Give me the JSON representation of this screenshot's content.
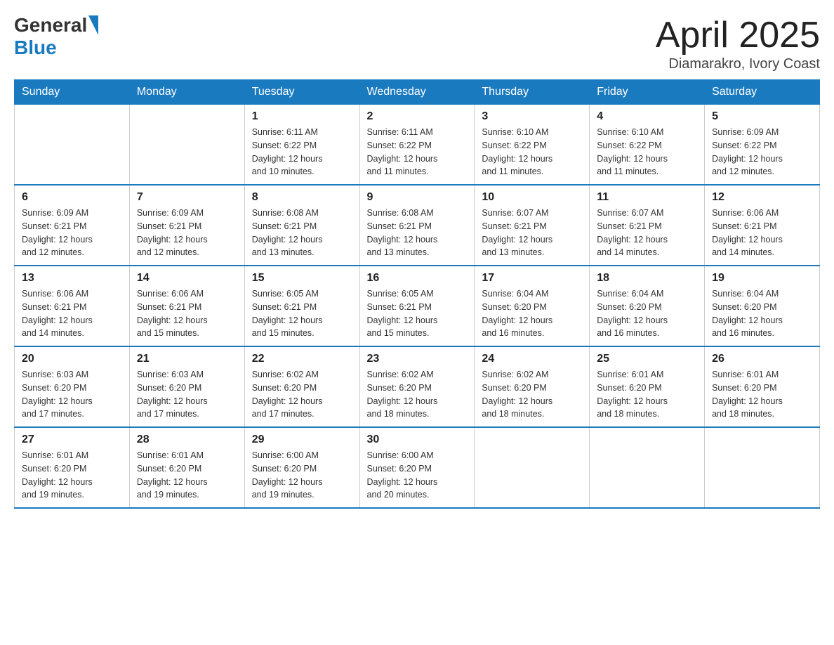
{
  "header": {
    "logo_general": "General",
    "logo_blue": "Blue",
    "month_title": "April 2025",
    "location": "Diamarakro, Ivory Coast"
  },
  "days_of_week": [
    "Sunday",
    "Monday",
    "Tuesday",
    "Wednesday",
    "Thursday",
    "Friday",
    "Saturday"
  ],
  "weeks": [
    [
      {
        "day": "",
        "info": ""
      },
      {
        "day": "",
        "info": ""
      },
      {
        "day": "1",
        "info": "Sunrise: 6:11 AM\nSunset: 6:22 PM\nDaylight: 12 hours\nand 10 minutes."
      },
      {
        "day": "2",
        "info": "Sunrise: 6:11 AM\nSunset: 6:22 PM\nDaylight: 12 hours\nand 11 minutes."
      },
      {
        "day": "3",
        "info": "Sunrise: 6:10 AM\nSunset: 6:22 PM\nDaylight: 12 hours\nand 11 minutes."
      },
      {
        "day": "4",
        "info": "Sunrise: 6:10 AM\nSunset: 6:22 PM\nDaylight: 12 hours\nand 11 minutes."
      },
      {
        "day": "5",
        "info": "Sunrise: 6:09 AM\nSunset: 6:22 PM\nDaylight: 12 hours\nand 12 minutes."
      }
    ],
    [
      {
        "day": "6",
        "info": "Sunrise: 6:09 AM\nSunset: 6:21 PM\nDaylight: 12 hours\nand 12 minutes."
      },
      {
        "day": "7",
        "info": "Sunrise: 6:09 AM\nSunset: 6:21 PM\nDaylight: 12 hours\nand 12 minutes."
      },
      {
        "day": "8",
        "info": "Sunrise: 6:08 AM\nSunset: 6:21 PM\nDaylight: 12 hours\nand 13 minutes."
      },
      {
        "day": "9",
        "info": "Sunrise: 6:08 AM\nSunset: 6:21 PM\nDaylight: 12 hours\nand 13 minutes."
      },
      {
        "day": "10",
        "info": "Sunrise: 6:07 AM\nSunset: 6:21 PM\nDaylight: 12 hours\nand 13 minutes."
      },
      {
        "day": "11",
        "info": "Sunrise: 6:07 AM\nSunset: 6:21 PM\nDaylight: 12 hours\nand 14 minutes."
      },
      {
        "day": "12",
        "info": "Sunrise: 6:06 AM\nSunset: 6:21 PM\nDaylight: 12 hours\nand 14 minutes."
      }
    ],
    [
      {
        "day": "13",
        "info": "Sunrise: 6:06 AM\nSunset: 6:21 PM\nDaylight: 12 hours\nand 14 minutes."
      },
      {
        "day": "14",
        "info": "Sunrise: 6:06 AM\nSunset: 6:21 PM\nDaylight: 12 hours\nand 15 minutes."
      },
      {
        "day": "15",
        "info": "Sunrise: 6:05 AM\nSunset: 6:21 PM\nDaylight: 12 hours\nand 15 minutes."
      },
      {
        "day": "16",
        "info": "Sunrise: 6:05 AM\nSunset: 6:21 PM\nDaylight: 12 hours\nand 15 minutes."
      },
      {
        "day": "17",
        "info": "Sunrise: 6:04 AM\nSunset: 6:20 PM\nDaylight: 12 hours\nand 16 minutes."
      },
      {
        "day": "18",
        "info": "Sunrise: 6:04 AM\nSunset: 6:20 PM\nDaylight: 12 hours\nand 16 minutes."
      },
      {
        "day": "19",
        "info": "Sunrise: 6:04 AM\nSunset: 6:20 PM\nDaylight: 12 hours\nand 16 minutes."
      }
    ],
    [
      {
        "day": "20",
        "info": "Sunrise: 6:03 AM\nSunset: 6:20 PM\nDaylight: 12 hours\nand 17 minutes."
      },
      {
        "day": "21",
        "info": "Sunrise: 6:03 AM\nSunset: 6:20 PM\nDaylight: 12 hours\nand 17 minutes."
      },
      {
        "day": "22",
        "info": "Sunrise: 6:02 AM\nSunset: 6:20 PM\nDaylight: 12 hours\nand 17 minutes."
      },
      {
        "day": "23",
        "info": "Sunrise: 6:02 AM\nSunset: 6:20 PM\nDaylight: 12 hours\nand 18 minutes."
      },
      {
        "day": "24",
        "info": "Sunrise: 6:02 AM\nSunset: 6:20 PM\nDaylight: 12 hours\nand 18 minutes."
      },
      {
        "day": "25",
        "info": "Sunrise: 6:01 AM\nSunset: 6:20 PM\nDaylight: 12 hours\nand 18 minutes."
      },
      {
        "day": "26",
        "info": "Sunrise: 6:01 AM\nSunset: 6:20 PM\nDaylight: 12 hours\nand 18 minutes."
      }
    ],
    [
      {
        "day": "27",
        "info": "Sunrise: 6:01 AM\nSunset: 6:20 PM\nDaylight: 12 hours\nand 19 minutes."
      },
      {
        "day": "28",
        "info": "Sunrise: 6:01 AM\nSunset: 6:20 PM\nDaylight: 12 hours\nand 19 minutes."
      },
      {
        "day": "29",
        "info": "Sunrise: 6:00 AM\nSunset: 6:20 PM\nDaylight: 12 hours\nand 19 minutes."
      },
      {
        "day": "30",
        "info": "Sunrise: 6:00 AM\nSunset: 6:20 PM\nDaylight: 12 hours\nand 20 minutes."
      },
      {
        "day": "",
        "info": ""
      },
      {
        "day": "",
        "info": ""
      },
      {
        "day": "",
        "info": ""
      }
    ]
  ]
}
